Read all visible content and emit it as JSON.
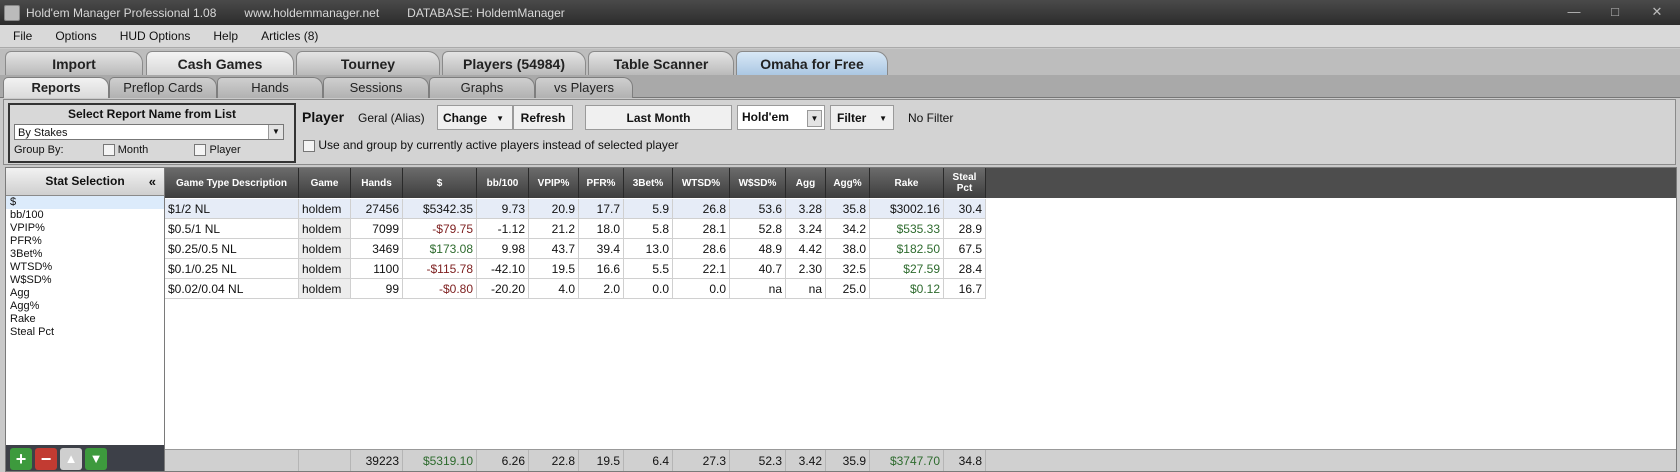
{
  "titlebar": {
    "app": "Hold'em Manager Professional 1.08",
    "site": "www.holdemmanager.net",
    "database": "DATABASE: HoldemManager",
    "min": "—",
    "max": "□",
    "close": "✕"
  },
  "menu": [
    "File",
    "Options",
    "HUD Options",
    "Help",
    "Articles (8)"
  ],
  "main_tabs": [
    "Import",
    "Cash Games",
    "Tourney",
    "Players (54984)",
    "Table Scanner",
    "Omaha for Free"
  ],
  "sub_tabs": [
    "Reports",
    "Preflop Cards",
    "Hands",
    "Sessions",
    "Graphs",
    "vs Players"
  ],
  "report": {
    "header": "Select Report Name from List",
    "selected": "By Stakes",
    "group_by": "Group By:",
    "month": "Month",
    "player": "Player"
  },
  "player_bar": {
    "label": "Player",
    "alias": "Geral (Alias)",
    "change": "Change",
    "refresh": "Refresh",
    "period": "Last Month",
    "game": "Hold'em",
    "filter": "Filter",
    "no_filter": "No Filter",
    "active_players": "Use and group by currently active players instead of selected player"
  },
  "stat_selection": {
    "title": "Stat Selection",
    "collapse": "«",
    "items": [
      "$",
      "bb/100",
      "VPIP%",
      "PFR%",
      "3Bet%",
      "WTSD%",
      "W$SD%",
      "Agg",
      "Agg%",
      "Rake",
      "Steal Pct"
    ],
    "buttons": {
      "add": "+",
      "remove": "−",
      "up": "▲",
      "down": "▼"
    }
  },
  "table": {
    "headers": [
      "Game Type Description",
      "Game",
      "Hands",
      "$",
      "bb/100",
      "VPIP%",
      "PFR%",
      "3Bet%",
      "WTSD%",
      "W$SD%",
      "Agg",
      "Agg%",
      "Rake",
      "Steal Pct"
    ],
    "rows": [
      [
        "$1/2 NL",
        "holdem",
        "27456",
        "$5342.35",
        "9.73",
        "20.9",
        "17.7",
        "5.9",
        "26.8",
        "53.6",
        "3.28",
        "35.8",
        "$3002.16",
        "30.4"
      ],
      [
        "$0.5/1 NL",
        "holdem",
        "7099",
        "-$79.75",
        "-1.12",
        "21.2",
        "18.0",
        "5.8",
        "28.1",
        "52.8",
        "3.24",
        "34.2",
        "$535.33",
        "28.9"
      ],
      [
        "$0.25/0.5 NL",
        "holdem",
        "3469",
        "$173.08",
        "9.98",
        "43.7",
        "39.4",
        "13.0",
        "28.6",
        "48.9",
        "4.42",
        "38.0",
        "$182.50",
        "67.5"
      ],
      [
        "$0.1/0.25 NL",
        "holdem",
        "1100",
        "-$115.78",
        "-42.10",
        "19.5",
        "16.6",
        "5.5",
        "22.1",
        "40.7",
        "2.30",
        "32.5",
        "$27.59",
        "28.4"
      ],
      [
        "$0.02/0.04 NL",
        "holdem",
        "99",
        "-$0.80",
        "-20.20",
        "4.0",
        "2.0",
        "0.0",
        "0.0",
        "na",
        "na",
        "25.0",
        "$0.12",
        "16.7"
      ]
    ],
    "totals": [
      "",
      "",
      "39223",
      "$5319.10",
      "6.26",
      "22.8",
      "19.5",
      "6.4",
      "27.3",
      "52.3",
      "3.42",
      "35.9",
      "$3747.70",
      "34.8"
    ]
  },
  "colors": {
    "positive": "#2e6b2e",
    "negative": "#7d1f1f",
    "selected_row": "#e6ecf7"
  }
}
